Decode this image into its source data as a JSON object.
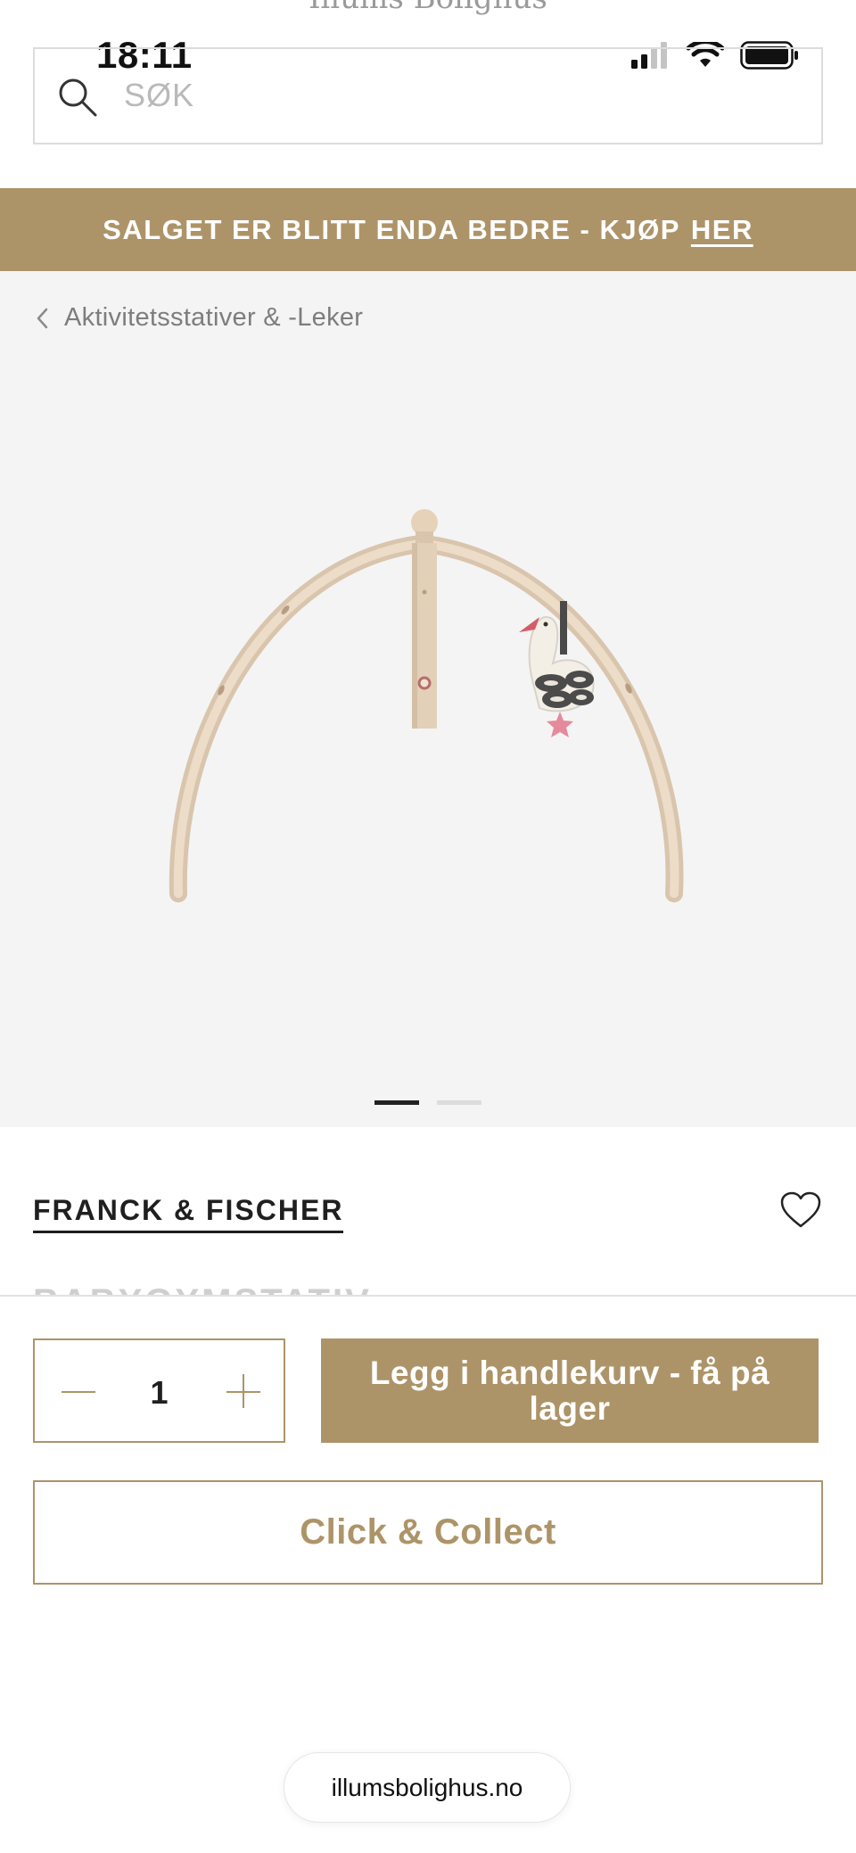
{
  "status_bar": {
    "time": "18:11"
  },
  "header": {
    "logo_text": "Illums Bolighus"
  },
  "search": {
    "placeholder": "SØK"
  },
  "promo": {
    "text": "SALGET ER BLITT ENDA BEDRE - KJØP",
    "link": "HER",
    "background": "#ad9468"
  },
  "breadcrumb": {
    "label": "Aktivitetsstativer & -Leker"
  },
  "gallery": {
    "slide_count": 2,
    "active_slide": 1
  },
  "product": {
    "brand": "FRANCK & FISCHER",
    "title_partial": "BABYGYMSTATIV"
  },
  "purchase": {
    "quantity": "1",
    "add_to_cart_label": "Legg i handlekurv - få på lager",
    "click_collect_label": "Click & Collect"
  },
  "browser": {
    "url": "illumsbolighus.no"
  },
  "colors": {
    "accent": "#ad9468",
    "text": "#1f1f1f",
    "gallery_bg": "#f4f4f4"
  }
}
